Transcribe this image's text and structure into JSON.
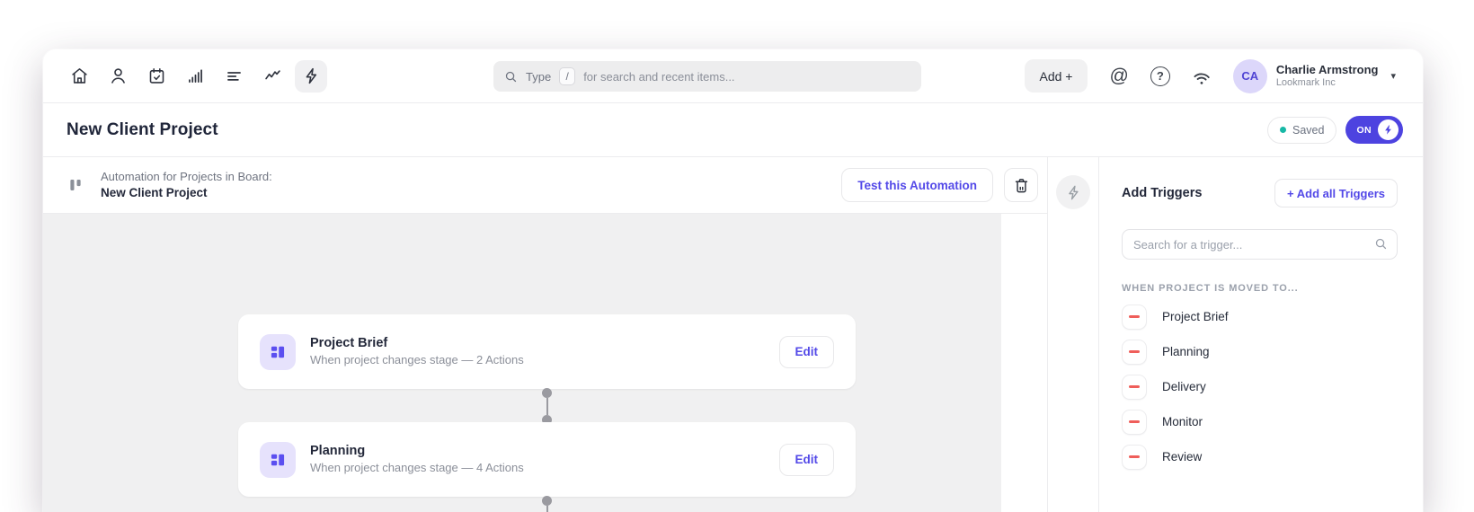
{
  "header": {
    "nav_icons": [
      "home-icon",
      "profile-icon",
      "calendar-check-icon",
      "bar-chart-icon",
      "list-icon",
      "trend-icon",
      "lightning-icon"
    ],
    "search": {
      "prefix": "Type",
      "key": "/",
      "suffix": "for search and recent items..."
    },
    "add_button_label": "Add +",
    "user": {
      "initials": "CA",
      "name": "Charlie Armstrong",
      "org": "Lookmark Inc"
    }
  },
  "title_bar": {
    "title": "New Client Project",
    "saved_label": "Saved",
    "toggle_label": "ON"
  },
  "automation_panel": {
    "context_label": "Automation for Projects in Board:",
    "board_name": "New Client Project",
    "test_button_label": "Test this Automation",
    "cards": [
      {
        "title": "Project Brief",
        "subtitle": "When project changes stage — 2 Actions",
        "edit_label": "Edit"
      },
      {
        "title": "Planning",
        "subtitle": "When project changes stage — 4 Actions",
        "edit_label": "Edit"
      }
    ]
  },
  "triggers_panel": {
    "title": "Add Triggers",
    "add_all_label": "+ Add all Triggers",
    "search_placeholder": "Search for a trigger...",
    "section_label": "WHEN PROJECT IS MOVED TO...",
    "items": [
      "Project Brief",
      "Planning",
      "Delivery",
      "Monitor",
      "Review"
    ]
  },
  "colors": {
    "accent_indigo": "#4d43e0",
    "tile_lavender": "#e6e2fc",
    "minus_coral": "#ef5e5a",
    "saved_teal": "#17b8a6",
    "canvas_gray": "#f0f0f1"
  }
}
